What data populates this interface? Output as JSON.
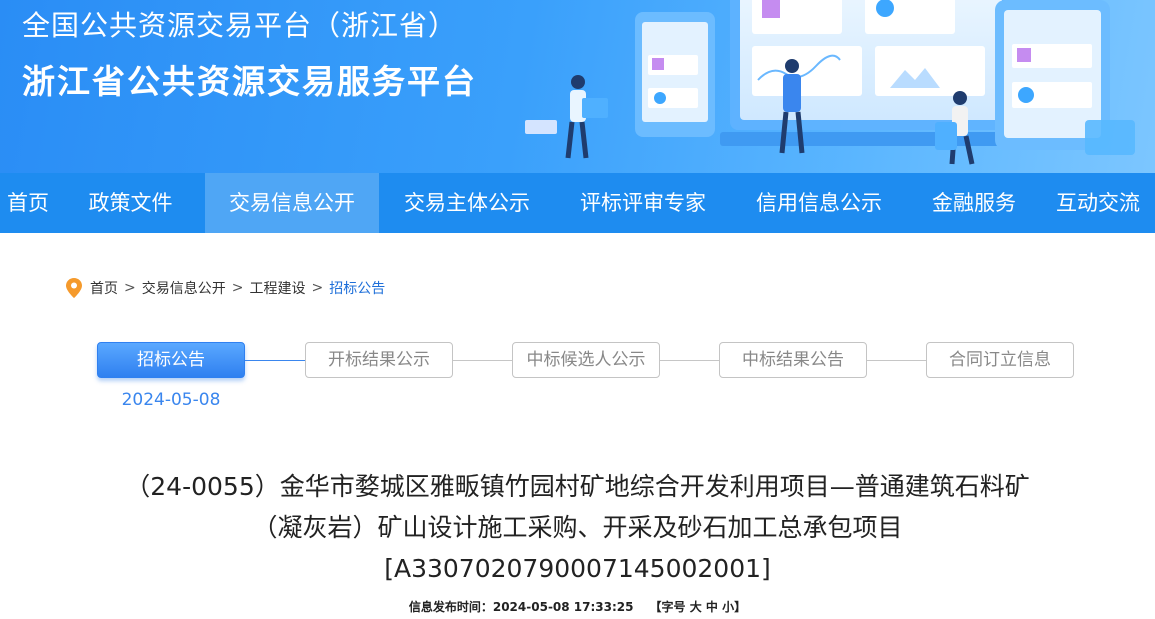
{
  "header": {
    "title_line1": "全国公共资源交易平台（浙江省）",
    "title_line2": "浙江省公共资源交易服务平台"
  },
  "nav": {
    "items": [
      {
        "label": "首页"
      },
      {
        "label": "政策文件"
      },
      {
        "label": "交易信息公开",
        "active": true
      },
      {
        "label": "交易主体公示"
      },
      {
        "label": "评标评审专家"
      },
      {
        "label": "信用信息公示"
      },
      {
        "label": "金融服务"
      },
      {
        "label": "互动交流"
      }
    ]
  },
  "breadcrumb": {
    "items": [
      "首页",
      "交易信息公开",
      "工程建设",
      "招标公告"
    ],
    "separator": ">"
  },
  "steps": {
    "items": [
      {
        "label": "招标公告",
        "active": true,
        "date": "2024-05-08"
      },
      {
        "label": "开标结果公示"
      },
      {
        "label": "中标候选人公示"
      },
      {
        "label": "中标结果公告"
      },
      {
        "label": "合同订立信息"
      }
    ]
  },
  "article": {
    "title_line1": "（24-0055）金华市婺城区雅畈镇竹园村矿地综合开发利用项目—普通建筑石料矿",
    "title_line2": "（凝灰岩）矿山设计施工采购、开采及砂石加工总承包项目",
    "title_line3": "[A3307020790007145002001]",
    "publish_label": "信息发布时间：",
    "publish_time": "2024-05-08 17:33:25",
    "font_size_open": "【字号",
    "font_size_large": "大",
    "font_size_medium": "中",
    "font_size_small": "小",
    "font_size_close": "】"
  },
  "colors": {
    "nav_bg": "#1e8cf0",
    "nav_active": "#4fa6f5",
    "accent": "#3a86ee"
  }
}
